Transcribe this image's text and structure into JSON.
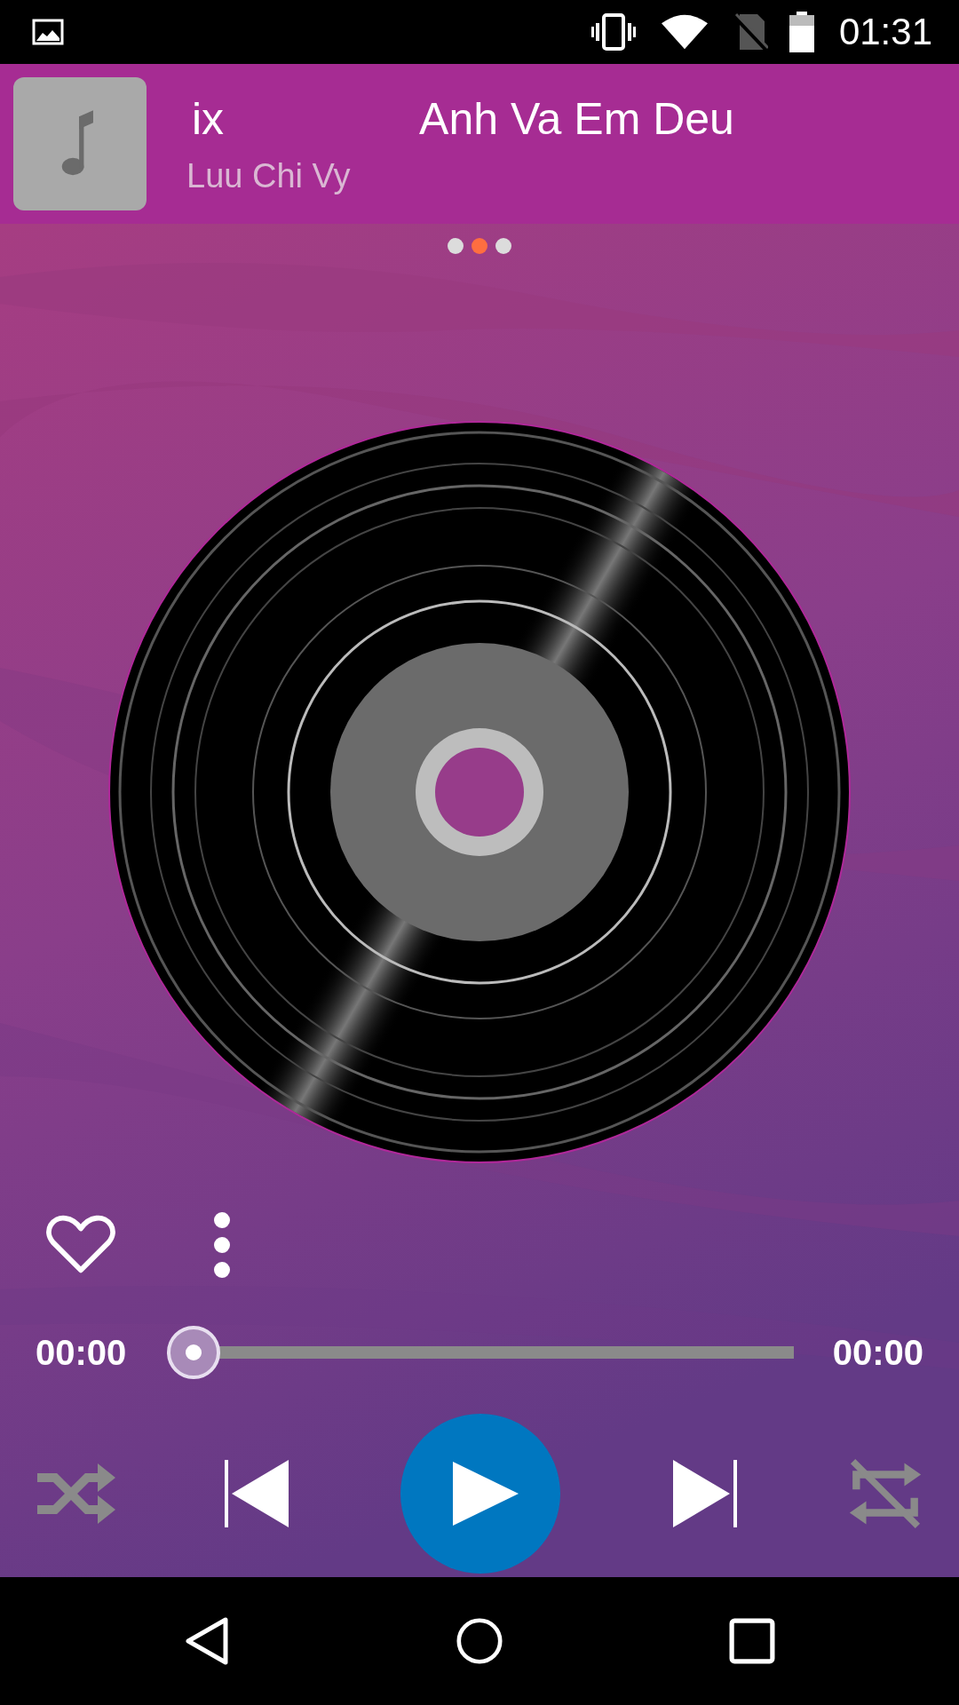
{
  "status_bar": {
    "time": "01:31"
  },
  "now_playing": {
    "title_parts": [
      "ix",
      "Anh Va Em Deu"
    ],
    "artist": "Luu Chi Vy"
  },
  "pages": [
    {
      "selected": false
    },
    {
      "selected": true
    },
    {
      "selected": false
    }
  ],
  "progress": {
    "elapsed": "00:00",
    "total": "00:00",
    "level": 0
  },
  "controls": {
    "shuffle": {
      "on": false
    },
    "repeat": {
      "on": false
    }
  }
}
